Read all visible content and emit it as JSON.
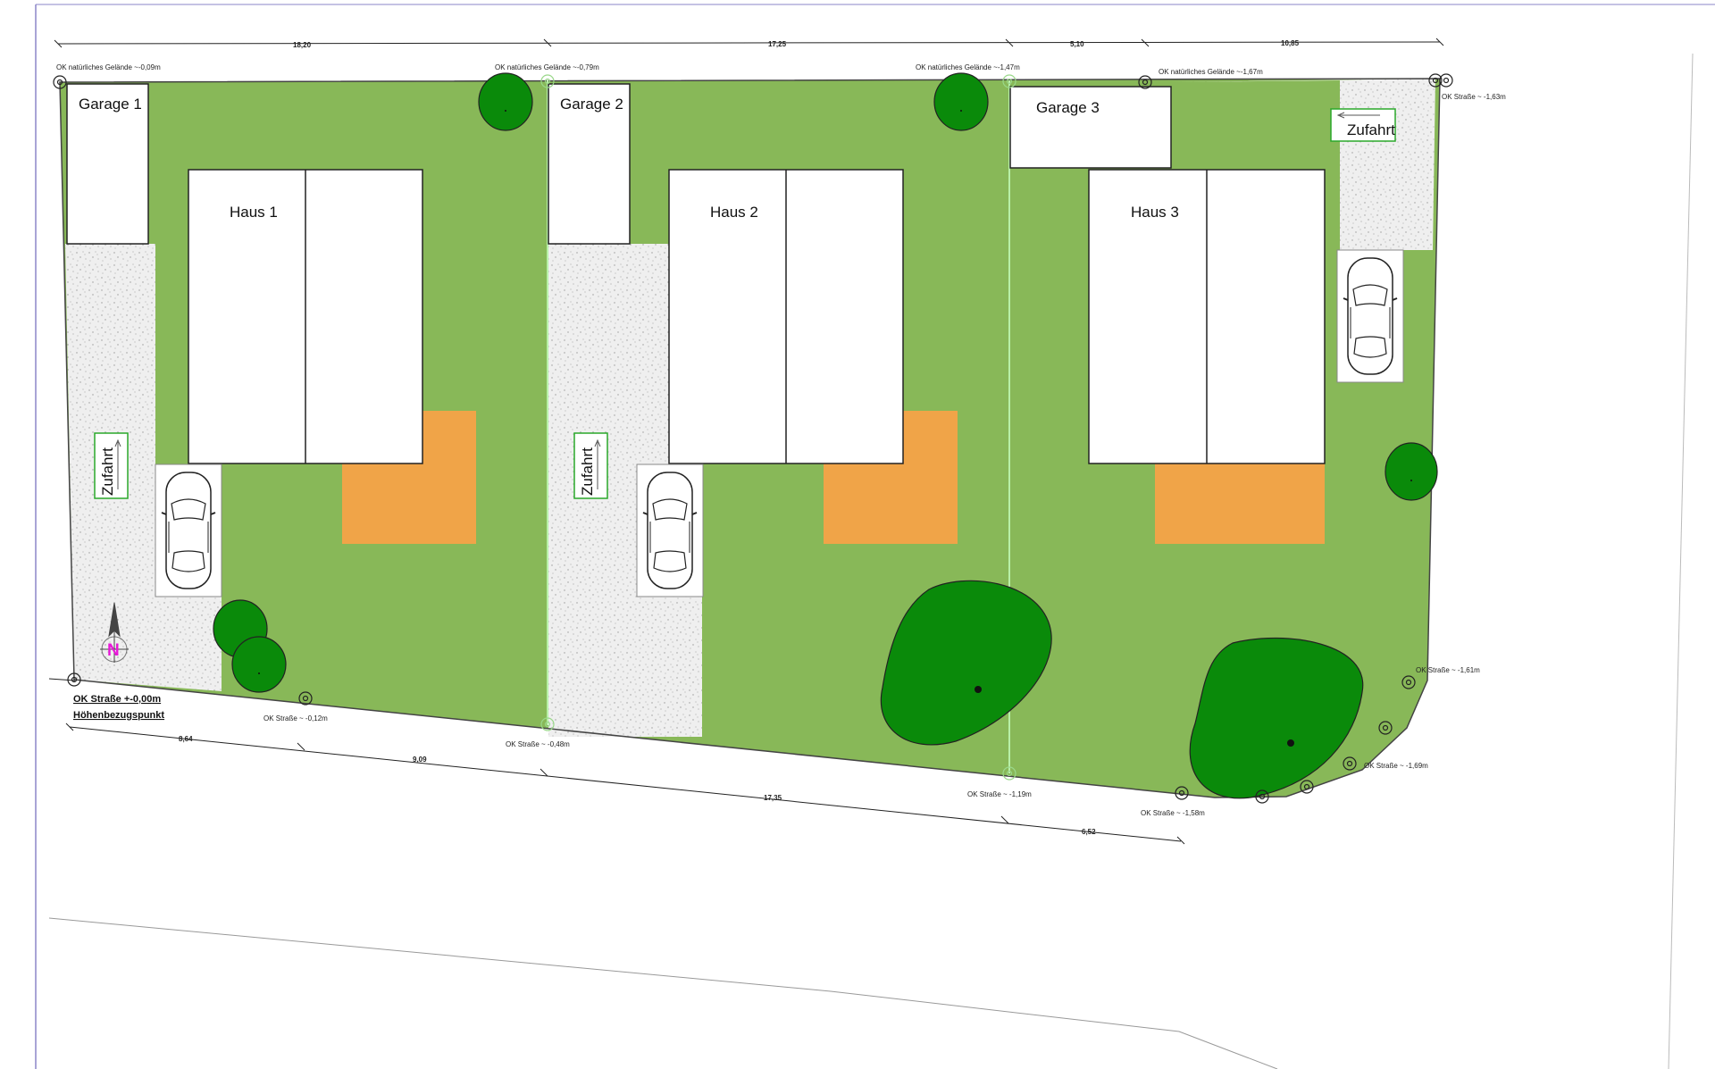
{
  "plan": {
    "buildings": {
      "haus1": "Haus 1",
      "haus2": "Haus 2",
      "haus3": "Haus 3",
      "garage1": "Garage 1",
      "garage2": "Garage 2",
      "garage3": "Garage 3"
    },
    "access": {
      "zufahrt1": "Zufahrt",
      "zufahrt2": "Zufahrt",
      "zufahrt3": "Zufahrt"
    },
    "dimensions_top": [
      "18,20",
      "17,25",
      "5,10",
      "10,85"
    ],
    "dimensions_bottom": [
      "8,64",
      "9,09",
      "17,35",
      "6,52"
    ],
    "elevations": {
      "g1": "OK natürliches Gelände ~-0,09m",
      "g2": "OK natürliches Gelände ~-0,79m",
      "g3": "OK natürliches Gelände ~-1,47m",
      "g4": "OK natürliches Gelände ~-1,67m",
      "s_top_right": "OK Straße ~ -1,63m",
      "s1": "OK Straße ~ -0,12m",
      "s2": "OK Straße ~ -0,48m",
      "s3": "OK Straße ~ -1,19m",
      "s4": "OK Straße ~ -1,58m",
      "s5": "OK Straße ~ -1,69m",
      "s6": "OK Straße ~ -1,61m"
    },
    "reference": {
      "line1": "OK Straße +-0,00m",
      "line2": "Höhenbezugspunkt"
    },
    "north": "N",
    "colors": {
      "lawn": "#88b858",
      "tree": "#0a8a0a",
      "terrace": "#f0a448",
      "gravel": "#efefef",
      "building": "#ffffff",
      "accent_north": "#e818d8",
      "frame": "#8b86c8"
    }
  }
}
